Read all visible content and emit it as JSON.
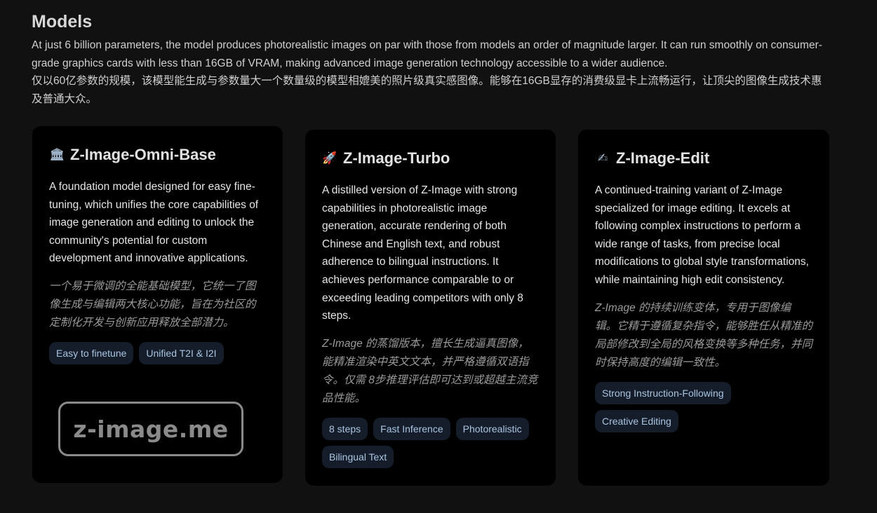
{
  "section": {
    "title": "Models",
    "description_en": "At just 6 billion parameters, the model produces photorealistic images on par with those from models an order of magnitude larger. It can run smoothly on consumer-grade graphics cards with less than 16GB of VRAM, making advanced image generation technology accessible to a wider audience.",
    "description_zh": "仅以60亿参数的规模，该模型能生成与参数量大一个数量级的模型相媲美的照片级真实感图像。能够在16GB显存的消费级显卡上流畅运行，让顶尖的图像生成技术惠及普通大众。"
  },
  "cards": [
    {
      "icon": "🏛",
      "icon_name": "classical-building-icon",
      "title": "Z-Image-Omni-Base",
      "body_en": "A foundation model designed for easy fine-tuning, which unifies the core capabilities of image generation and editing to unlock the community's potential for custom development and innovative applications.",
      "body_zh": "一个易于微调的全能基础模型，它统一了图像生成与编辑两大核心功能，旨在为社区的定制化开发与创新应用释放全部潜力。",
      "tags": [
        "Easy to finetune",
        "Unified T2I & I2I"
      ]
    },
    {
      "icon": "🚀",
      "icon_name": "rocket-icon",
      "title": "Z-Image-Turbo",
      "body_en": "A distilled version of Z-Image with strong capabilities in photorealistic image generation, accurate rendering of both Chinese and English text, and robust adherence to bilingual instructions. It achieves performance comparable to or exceeding leading competitors with only 8 steps.",
      "body_zh": "Z-Image 的蒸馏版本，擅长生成逼真图像，能精准渲染中英文文本，并严格遵循双语指令。仅需 8步推理评估即可达到或超越主流竞品性能。",
      "tags": [
        "8 steps",
        "Fast Inference",
        "Photorealistic",
        "Bilingual Text"
      ]
    },
    {
      "icon": "✍",
      "icon_name": "writing-hand-icon",
      "title": "Z-Image-Edit",
      "body_en": "A continued-training variant of Z-Image specialized for image editing. It excels at following complex instructions to perform a wide range of tasks, from precise local modifications to global style transformations, while maintaining high edit consistency.",
      "body_zh": "Z-Image 的持续训练变体，专用于图像编辑。它精于遵循复杂指令，能够胜任从精准的局部修改到全局的风格变换等多种任务，并同时保持高度的编辑一致性。",
      "tags": [
        "Strong Instruction-Following",
        "Creative Editing"
      ]
    }
  ],
  "watermark": {
    "text": "z-image.me"
  }
}
